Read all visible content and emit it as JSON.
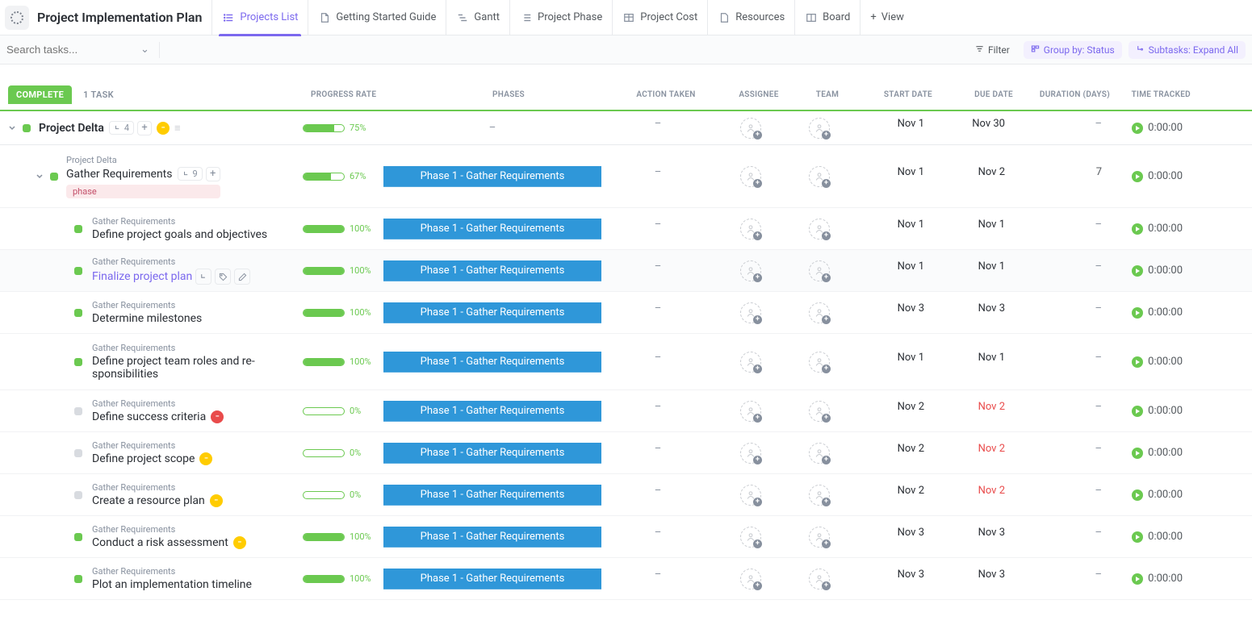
{
  "header": {
    "title": "Project Implementation Plan",
    "tabs": [
      {
        "label": "Projects List",
        "active": true
      },
      {
        "label": "Getting Started Guide",
        "active": false
      },
      {
        "label": "Gantt",
        "active": false
      },
      {
        "label": "Project Phase",
        "active": false
      },
      {
        "label": "Project Cost",
        "active": false
      },
      {
        "label": "Resources",
        "active": false
      },
      {
        "label": "Board",
        "active": false
      }
    ],
    "add_view_label": "View"
  },
  "filterbar": {
    "search_placeholder": "Search tasks...",
    "filter_label": "Filter",
    "group_label": "Group by: Status",
    "subtasks_label": "Subtasks: Expand All"
  },
  "status_group": {
    "badge": "COMPLETE",
    "count_label": "1 TASK"
  },
  "columns": {
    "progress": "PROGRESS RATE",
    "phases": "PHASES",
    "action": "ACTION TAKEN",
    "assignee": "ASSIGNEE",
    "team": "TEAM",
    "start": "START DATE",
    "due": "DUE DATE",
    "duration": "DURATION (DAYS)",
    "time": "TIME TRACKED"
  },
  "phase_label": "Phase 1 - Gather Requirements",
  "tag_phase": "phase",
  "time_zero": "0:00:00",
  "project": {
    "name": "Project Delta",
    "subtask_count": "4",
    "progress": 75,
    "start": "Nov 1",
    "due": "Nov 30"
  },
  "gather": {
    "parent": "Project Delta",
    "name": "Gather Requirements",
    "subtask_count": "9",
    "progress": 67,
    "start": "Nov 1",
    "due": "Nov 2",
    "duration": "7"
  },
  "tasks": [
    {
      "parent": "Gather Requirements",
      "name": "Define project goals and objectives",
      "progress": 100,
      "start": "Nov 1",
      "due": "Nov 1",
      "status_color": "green",
      "badge": null,
      "due_red": false,
      "hovered": false
    },
    {
      "parent": "Gather Requirements",
      "name": "Finalize project plan",
      "progress": 100,
      "start": "Nov 1",
      "due": "Nov 1",
      "status_color": "green",
      "badge": null,
      "due_red": false,
      "hovered": true,
      "purple": true
    },
    {
      "parent": "Gather Requirements",
      "name": "Determine milestones",
      "progress": 100,
      "start": "Nov 3",
      "due": "Nov 3",
      "status_color": "green",
      "badge": null,
      "due_red": false,
      "hovered": false
    },
    {
      "parent": "Gather Requirements",
      "name": "Define project team roles and responsibilities",
      "progress": 100,
      "start": "Nov 1",
      "due": "Nov 1",
      "status_color": "green",
      "badge": null,
      "due_red": false,
      "hovered": false
    },
    {
      "parent": "Gather Requirements",
      "name": "Define success criteria",
      "progress": 0,
      "start": "Nov 2",
      "due": "Nov 2",
      "status_color": "grey",
      "badge": "red",
      "due_red": true,
      "hovered": false
    },
    {
      "parent": "Gather Requirements",
      "name": "Define project scope",
      "progress": 0,
      "start": "Nov 2",
      "due": "Nov 2",
      "status_color": "grey",
      "badge": "yellow",
      "due_red": true,
      "hovered": false
    },
    {
      "parent": "Gather Requirements",
      "name": "Create a resource plan",
      "progress": 0,
      "start": "Nov 2",
      "due": "Nov 2",
      "status_color": "grey",
      "badge": "yellow",
      "due_red": true,
      "hovered": false
    },
    {
      "parent": "Gather Requirements",
      "name": "Conduct a risk assessment",
      "progress": 100,
      "start": "Nov 3",
      "due": "Nov 3",
      "status_color": "green",
      "badge": "yellow",
      "due_red": false,
      "hovered": false
    },
    {
      "parent": "Gather Requirements",
      "name": "Plot an implementation timeline",
      "progress": 100,
      "start": "Nov 3",
      "due": "Nov 3",
      "status_color": "green",
      "badge": null,
      "due_red": false,
      "hovered": false
    }
  ]
}
